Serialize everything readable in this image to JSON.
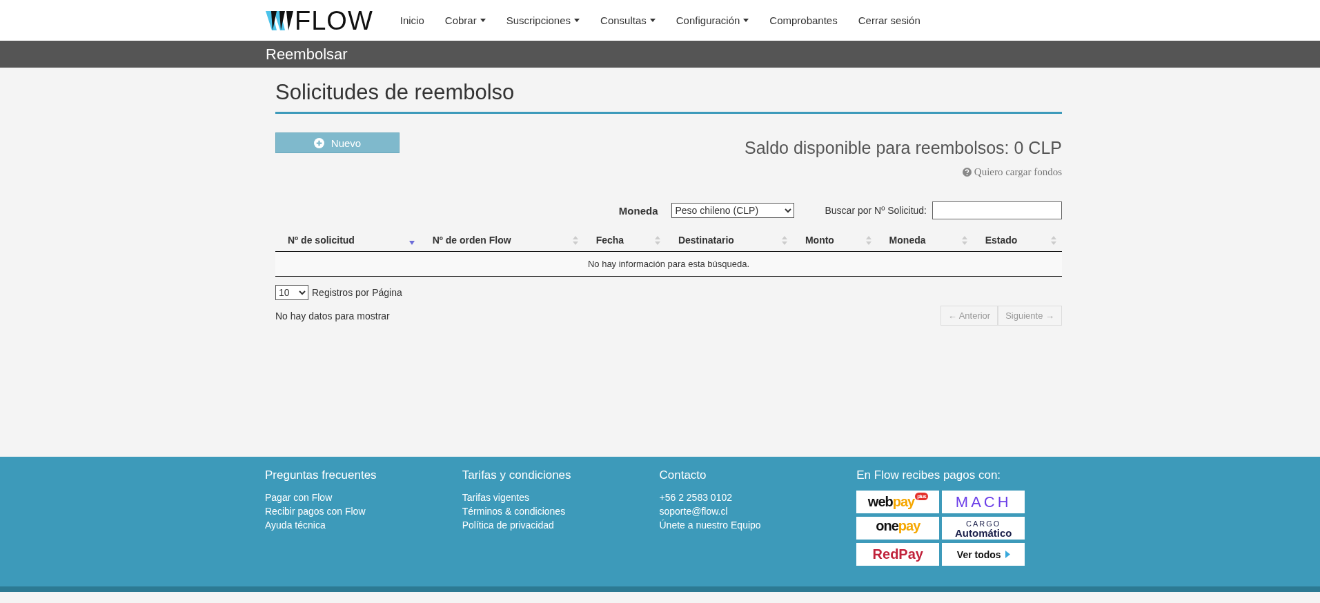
{
  "brand": {
    "name": "FLOW"
  },
  "nav": [
    {
      "label": "Inicio",
      "dropdown": false
    },
    {
      "label": "Cobrar",
      "dropdown": true
    },
    {
      "label": "Suscripciones",
      "dropdown": true
    },
    {
      "label": "Consultas",
      "dropdown": true
    },
    {
      "label": "Configuración",
      "dropdown": true
    },
    {
      "label": "Comprobantes",
      "dropdown": false
    },
    {
      "label": "Cerrar sesión",
      "dropdown": false
    }
  ],
  "page_bar": {
    "title": "Reembolsar"
  },
  "heading": "Solicitudes de reembolso",
  "new_button": {
    "label": "Nuevo"
  },
  "balance": {
    "text": "Saldo disponible para reembolsos: 0 CLP",
    "link": "Quiero cargar fondos"
  },
  "filters": {
    "currency_label": "Moneda",
    "currency_value": "Peso chileno (CLP)",
    "search_label": "Buscar por Nº Solicitud:"
  },
  "table": {
    "columns": [
      {
        "label": "Nº de solicitud",
        "sorted": true
      },
      {
        "label": "Nº de orden Flow",
        "sorted": false
      },
      {
        "label": "Fecha",
        "sorted": false
      },
      {
        "label": "Destinatario",
        "sorted": false
      },
      {
        "label": "Monto",
        "sorted": false
      },
      {
        "label": "Moneda",
        "sorted": false
      },
      {
        "label": "Estado",
        "sorted": false
      }
    ],
    "empty_message": "No hay información para esta búsqueda."
  },
  "page_size": {
    "value": "10",
    "label": "Registros por Página"
  },
  "info": "No hay datos para mostrar",
  "pagination": [
    {
      "label": "← Anterior",
      "disabled": true
    },
    {
      "label": "Siguiente →",
      "disabled": true
    }
  ],
  "footer": {
    "columns": [
      {
        "title": "Preguntas frecuentes",
        "links": [
          "Pagar con Flow",
          "Recibir pagos con Flow",
          "Ayuda técnica"
        ]
      },
      {
        "title": "Tarifas y condiciones",
        "links": [
          "Tarifas vigentes",
          "Términos & condiciones",
          "Política de privacidad"
        ]
      },
      {
        "title": "Contacto",
        "links": [
          "+56 2 2583 0102",
          "soporte@flow.cl",
          "Únete a nuestro Equipo"
        ]
      }
    ],
    "payments_title": "En Flow recibes pagos con:",
    "payments": [
      {
        "kind": "webpay",
        "text": "web",
        "text2": "pay",
        "badge": "plus"
      },
      {
        "kind": "mach",
        "text": "MACH"
      },
      {
        "kind": "onepay",
        "text": "one",
        "text2": "pay"
      },
      {
        "kind": "cargo",
        "text": "CARGO",
        "text2": "Automático"
      },
      {
        "kind": "redpay",
        "text": "RedPay"
      },
      {
        "kind": "link",
        "text": "Ver todos"
      }
    ]
  }
}
